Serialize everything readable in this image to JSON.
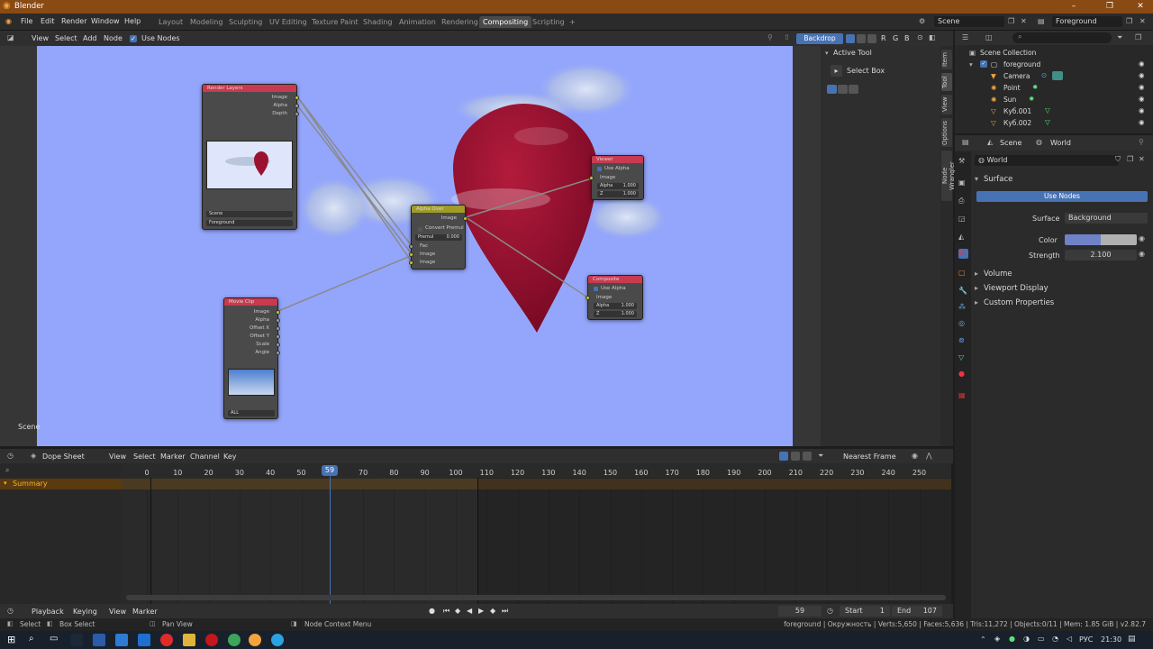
{
  "window": {
    "title": "Blender",
    "btn_min": "–",
    "btn_max": "❐",
    "btn_close": "✕"
  },
  "menu": {
    "items": [
      "File",
      "Edit",
      "Render",
      "Window",
      "Help"
    ]
  },
  "workspaces": {
    "tabs": [
      "Layout",
      "Modeling",
      "Sculpting",
      "UV Editing",
      "Texture Paint",
      "Shading",
      "Animation",
      "Rendering",
      "Compositing",
      "Scripting"
    ],
    "add": "+",
    "active": "Compositing"
  },
  "top_right": {
    "scene": "Scene",
    "view_layer": "Foreground"
  },
  "node_editor": {
    "menu": [
      "View",
      "Select",
      "Add",
      "Node"
    ],
    "use_nodes": "Use Nodes",
    "backdrop": "Backdrop",
    "channels": [
      "R",
      "G",
      "B"
    ],
    "scene_label": "Scene",
    "nodes": {
      "render_layers": {
        "title": "Render Layers",
        "outputs": [
          "Image",
          "Alpha",
          "Depth"
        ],
        "scene": "Scene",
        "layer": "Foreground"
      },
      "movie_clip": {
        "title": "Movie Clip",
        "outputs": [
          "Image",
          "Alpha",
          "Offset X",
          "Offset Y",
          "Scale",
          "Angle"
        ],
        "clip": "ALL"
      },
      "alpha_over": {
        "title": "Alpha Over",
        "output": "Image",
        "convert": "Convert Premul",
        "premul_label": "Premul",
        "premul_value": "0.000",
        "inputs": [
          "Fac",
          "Image",
          "Image"
        ]
      },
      "viewer": {
        "title": "Viewer",
        "use_alpha": "Use Alpha",
        "input": "Image",
        "alpha_label": "Alpha",
        "alpha_value": "1.000",
        "z_label": "Z",
        "z_value": "1.000"
      },
      "composite": {
        "title": "Composite",
        "use_alpha": "Use Alpha",
        "input": "Image",
        "alpha_label": "Alpha",
        "alpha_value": "1.000",
        "z_label": "Z",
        "z_value": "1.000"
      }
    }
  },
  "tool_panel": {
    "header": "Active Tool",
    "tool": "Select Box",
    "tabs": [
      "Item",
      "Tool",
      "View",
      "Options",
      "Node Wrangler"
    ]
  },
  "outliner": {
    "root": "Scene Collection",
    "items": [
      {
        "name": "foreground"
      },
      {
        "name": "Camera"
      },
      {
        "name": "Point"
      },
      {
        "name": "Sun"
      },
      {
        "name": "Куб.001"
      },
      {
        "name": "Куб.002"
      }
    ]
  },
  "properties": {
    "breadcrumb_scene": "Scene",
    "breadcrumb_world": "World",
    "world_name": "World",
    "surface_section": "Surface",
    "use_nodes": "Use Nodes",
    "surface_label": "Surface",
    "surface_value": "Background",
    "color_label": "Color",
    "strength_label": "Strength",
    "strength_value": "2.100",
    "sections": [
      "Volume",
      "Viewport Display",
      "Custom Properties"
    ]
  },
  "dope_sheet": {
    "mode": "Dope Sheet",
    "menu": [
      "View",
      "Select",
      "Marker",
      "Channel",
      "Key"
    ],
    "snap": "Nearest Frame",
    "summary": "Summary",
    "ticks": [
      0,
      10,
      20,
      30,
      40,
      50,
      70,
      80,
      90,
      100,
      110,
      120,
      130,
      140,
      150,
      160,
      170,
      180,
      190,
      200,
      210,
      220,
      230,
      240,
      250
    ],
    "current_frame": "59"
  },
  "timeline": {
    "menu": [
      "Playback",
      "Keying",
      "View",
      "Marker"
    ],
    "current": "59",
    "start_label": "Start",
    "start": "1",
    "end_label": "End",
    "end": "107"
  },
  "status": {
    "select": "Select",
    "box_select": "Box Select",
    "pan_view": "Pan View",
    "context_menu": "Node Context Menu",
    "stats": "foreground | Окружность | Verts:5,650 | Faces:5,636 | Tris:11,272 | Objects:0/11 | Mem: 1.85 GiB | v2.82.7"
  },
  "taskbar": {
    "lang": "РУС",
    "time": "21:30"
  },
  "colors": {
    "accent": "#4772b3",
    "node_input": "#c83a4f",
    "node_alpha": "#a19b27",
    "backdrop": "#94a6fb",
    "marker": "#f5b52c",
    "titlebar": "#8a4a14"
  }
}
